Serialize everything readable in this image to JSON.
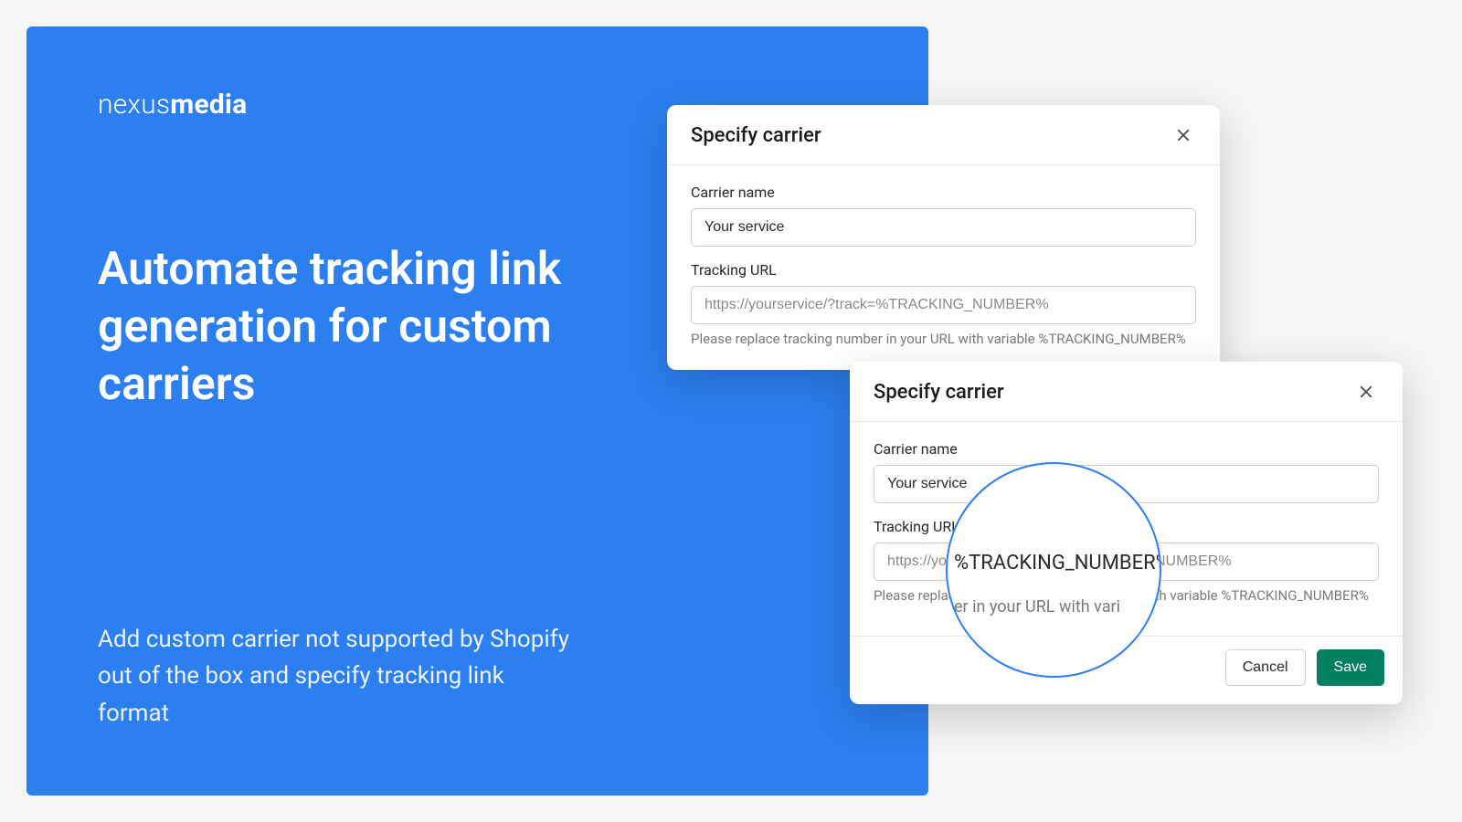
{
  "brand": {
    "light": "nexus",
    "bold": "media"
  },
  "headline": "Automate tracking link generation for custom carriers",
  "subtext": "Add custom carrier not supported by Shopify out of the box and specify tracking link format",
  "modal": {
    "title": "Specify carrier",
    "carrier_label": "Carrier name",
    "carrier_value": "Your service",
    "url_label": "Tracking URL",
    "url_placeholder": "https://yourservice/?track=%TRACKING_NUMBER%",
    "helper": "Please replace tracking number in your URL with variable %TRACKING_NUMBER%",
    "cancel": "Cancel",
    "save": "Save"
  },
  "magnifier": {
    "token": "%TRACKING_NUMBER%",
    "sub": "er in your URL with vari"
  }
}
